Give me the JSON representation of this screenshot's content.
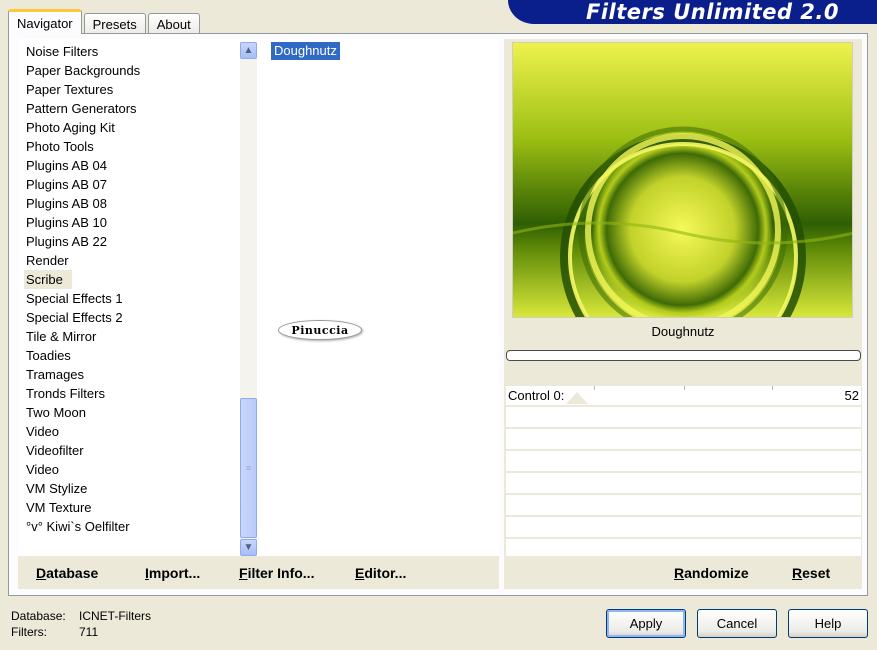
{
  "tabs": [
    {
      "label": "Navigator",
      "active": true
    },
    {
      "label": "Presets",
      "active": false
    },
    {
      "label": "About",
      "active": false
    }
  ],
  "banner": {
    "title": "Filters Unlimited 2.0"
  },
  "categories": {
    "items": [
      "Noise Filters",
      "Paper Backgrounds",
      "Paper Textures",
      "Pattern Generators",
      "Photo Aging Kit",
      "Photo Tools",
      "Plugins AB 04",
      "Plugins AB 07",
      "Plugins AB 08",
      "Plugins AB 10",
      "Plugins AB 22",
      "Render",
      "Scribe",
      "Special Effects 1",
      "Special Effects 2",
      "Tile & Mirror",
      "Toadies",
      "Tramages",
      "Tronds Filters",
      "Two Moon",
      "Video",
      "Videofilter",
      "Video",
      "VM Stylize",
      "VM Texture",
      "°v° Kiwi`s Oelfilter"
    ],
    "selected": "Scribe"
  },
  "filters": {
    "items": [
      "Doughnutz"
    ],
    "selected": "Doughnutz",
    "logo_text": "Pinuccia"
  },
  "preview": {
    "filter_name": "Doughnutz",
    "colors": {
      "bright": "#f2f55a",
      "dark": "#2f5e03"
    }
  },
  "controls": [
    {
      "label": "Control 0:",
      "value": "52"
    }
  ],
  "left_buttons": {
    "database": "Database",
    "import": "Import...",
    "filter_info": "Filter Info...",
    "editor": "Editor..."
  },
  "right_buttons": {
    "randomize": "Randomize",
    "reset": "Reset"
  },
  "status": {
    "database_label": "Database:",
    "database_value": "ICNET-Filters",
    "filters_label": "Filters:",
    "filters_value": "711"
  },
  "dialog_buttons": {
    "apply": "Apply",
    "cancel": "Cancel",
    "help": "Help"
  }
}
